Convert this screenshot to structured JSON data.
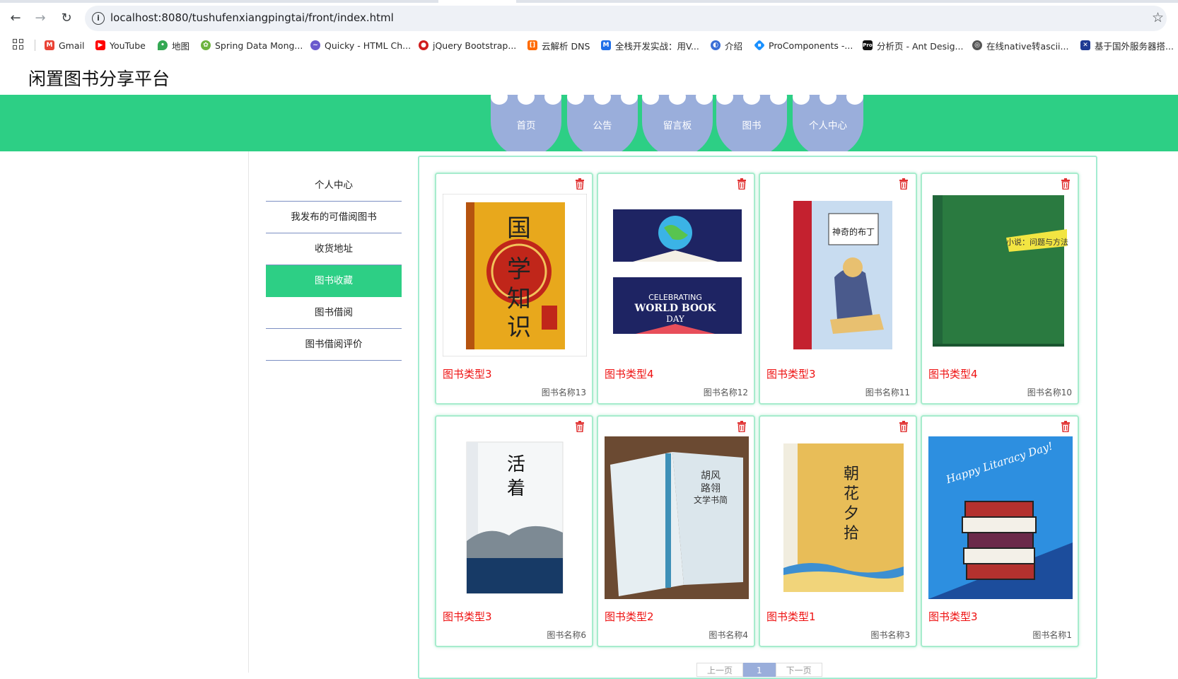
{
  "browser": {
    "url": "localhost:8080/tushufenxiangpingtai/front/index.html",
    "bookmarks": [
      {
        "label": "Gmail",
        "icon": "gmail-icon",
        "color": "#ea4335"
      },
      {
        "label": "YouTube",
        "icon": "youtube-icon",
        "color": "#ff0000"
      },
      {
        "label": "地图",
        "icon": "maps-icon",
        "color": "#34a853"
      },
      {
        "label": "Spring Data Mong...",
        "icon": "spring-icon",
        "color": "#6db33f"
      },
      {
        "label": "Quicky - HTML Ch...",
        "icon": "quicky-icon",
        "color": "#6a5acd"
      },
      {
        "label": "jQuery Bootstrap...",
        "icon": "jquery-icon",
        "color": "#d01c1c"
      },
      {
        "label": "云解析 DNS",
        "icon": "aliyun-icon",
        "color": "#ff6a00"
      },
      {
        "label": "全栈开发实战：用V...",
        "icon": "m-icon",
        "color": "#1e6ee8"
      },
      {
        "label": "介绍",
        "icon": "globe-icon",
        "color": "#3b6fd6"
      },
      {
        "label": "ProComponents -...",
        "icon": "procomponents-icon",
        "color": "#1890ff"
      },
      {
        "label": "分析页 - Ant Desig...",
        "icon": "pro-icon",
        "color": "#111111"
      },
      {
        "label": "在线native转ascii...",
        "icon": "web-icon",
        "color": "#555555"
      },
      {
        "label": "基于国外服务器搭...",
        "icon": "flag-icon",
        "color": "#1f3a93"
      }
    ]
  },
  "site": {
    "title": "闲置图书分享平台",
    "nav": [
      "首页",
      "公告",
      "留言板",
      "图书",
      "个人中心"
    ]
  },
  "side_menu": {
    "items": [
      "个人中心",
      "我发布的可借阅图书",
      "收货地址",
      "图书收藏",
      "图书借阅",
      "图书借阅评价"
    ],
    "active": "图书收藏"
  },
  "books": [
    {
      "type": "图书类型3",
      "name": "图书名称13",
      "cover_title": "国学知识"
    },
    {
      "type": "图书类型4",
      "name": "图书名称12",
      "cover_title": "WORLD BOOK DAY"
    },
    {
      "type": "图书类型3",
      "name": "图书名称11",
      "cover_title": "神奇的布丁"
    },
    {
      "type": "图书类型4",
      "name": "图书名称10",
      "cover_title": "小说：问题与方法"
    },
    {
      "type": "图书类型3",
      "name": "图书名称6",
      "cover_title": "活着"
    },
    {
      "type": "图书类型2",
      "name": "图书名称4",
      "cover_title": "文学书简"
    },
    {
      "type": "图书类型1",
      "name": "图书名称3",
      "cover_title": "朝花夕拾"
    },
    {
      "type": "图书类型3",
      "name": "图书名称1",
      "cover_title": "Happy Litaracy Day!"
    }
  ],
  "pagination": {
    "prev": "上一页",
    "current": "1",
    "next": "下一页"
  },
  "colors": {
    "brand_green": "#2dcf85",
    "nav_blue": "#9aaedb",
    "type_red": "#ee1111"
  }
}
